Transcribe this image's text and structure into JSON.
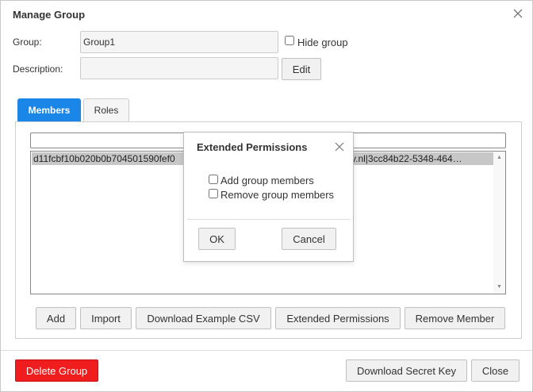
{
  "dialog": {
    "title": "Manage Group",
    "close_icon": "close-icon"
  },
  "group": {
    "label": "Group:",
    "value": "Group1",
    "hide_label": "Hide group",
    "hide_checked": false
  },
  "description": {
    "label": "Description:",
    "value": "",
    "edit_label": "Edit"
  },
  "tabs": [
    {
      "label": "Members",
      "active": true
    },
    {
      "label": "Roles",
      "active": false
    }
  ],
  "members": {
    "filter_value": "",
    "items": [
      {
        "left": "d11fcbf10b020b0b704501590fef0",
        "right": "y.nl|3cc84b22-5348-464…"
      }
    ],
    "buttons": {
      "add": "Add",
      "import": "Import",
      "download_csv": "Download Example CSV",
      "extended_permissions": "Extended Permissions",
      "remove_member": "Remove Member"
    }
  },
  "footer": {
    "delete_group": "Delete Group",
    "download_secret_key": "Download Secret Key",
    "close": "Close"
  },
  "modal": {
    "title": "Extended Permissions",
    "options": [
      {
        "label": "Add group members",
        "checked": false
      },
      {
        "label": "Remove group members",
        "checked": false
      }
    ],
    "ok": "OK",
    "cancel": "Cancel"
  },
  "colors": {
    "accent": "#1a86e8",
    "danger": "#ef1d1d",
    "selection": "#c7c7c7"
  }
}
